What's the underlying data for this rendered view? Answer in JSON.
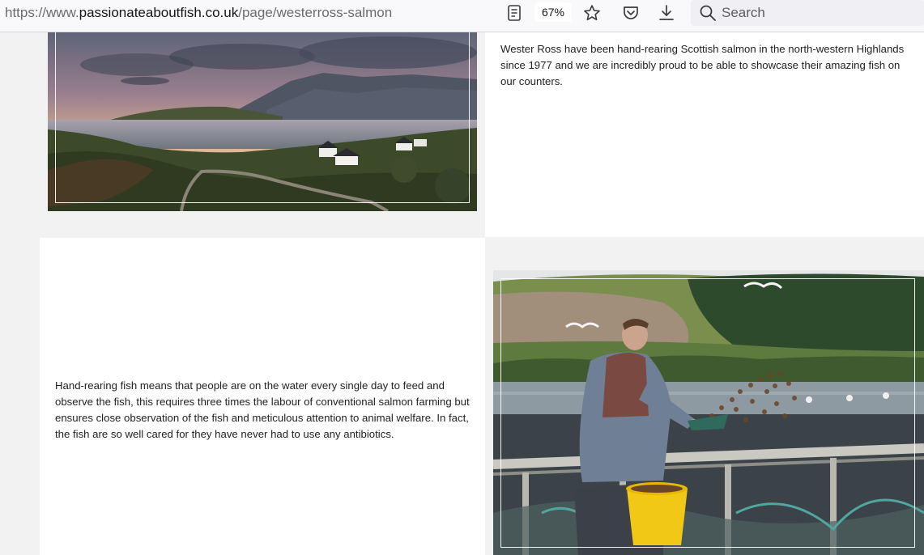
{
  "browser": {
    "url_prefix": "https://www.",
    "url_host": "passionateaboutfish.co.uk",
    "url_path": "/page/westerross-salmon",
    "zoom": "67%",
    "search_label": "Search",
    "icons": [
      "reader-view-icon",
      "bookmark-star-icon",
      "pocket-icon",
      "download-icon",
      "search-icon"
    ]
  },
  "content": {
    "intro_text": "Wester Ross have been hand-rearing Scottish salmon in the north-western Highlands since 1977 and we are incredibly proud to be able to showcase their amazing fish on our counters.",
    "body_text": "Hand-rearing fish means that people are on the water every single day to feed and observe the fish, this requires three times the labour of conventional salmon farming but ensures close observation of the fish and meticulous attention to animal welfare. In fact, the fish are so well cared for they have never had to use any antibiotics."
  },
  "colors": {
    "page_background": "#f2f2f2",
    "panel": "#ffffff",
    "text": "#222222"
  }
}
